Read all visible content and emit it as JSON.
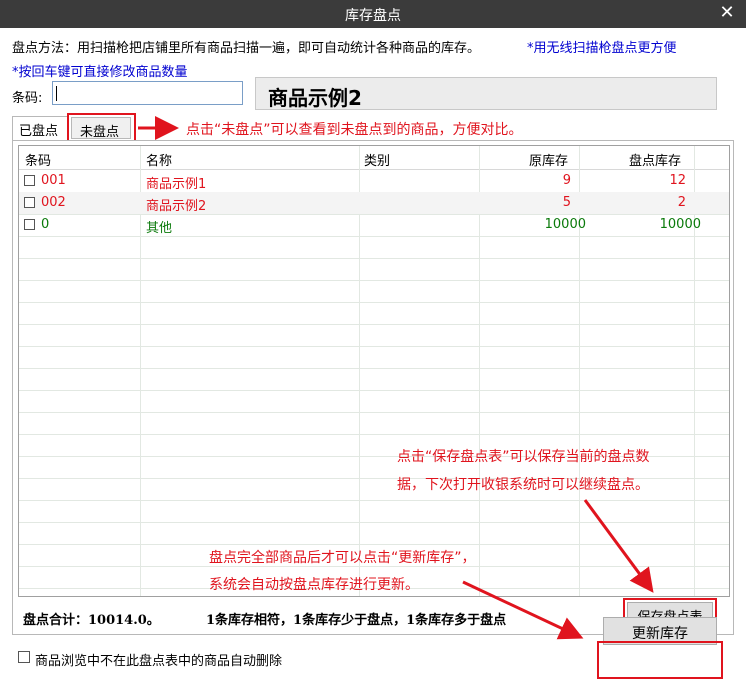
{
  "window": {
    "title": "库存盘点",
    "close_glyph": "✕"
  },
  "info": {
    "method_text": "盘点方法：用扫描枪把店铺里所有商品扫描一遍，即可自动统计各种商品的库存。",
    "wireless_tip": "*用无线扫描枪盘点更方便",
    "enter_tip": "*按回车键可直接修改商品数量"
  },
  "barcode": {
    "label": "条码:",
    "value": ""
  },
  "product_name": "商品示例2",
  "tabs": {
    "counted": "已盘点",
    "uncounted": "未盘点"
  },
  "table": {
    "headers": [
      "条码",
      "名称",
      "类别",
      "原库存",
      "盘点库存"
    ],
    "rows": [
      {
        "code": "001",
        "name": "商品示例1",
        "category": "",
        "orig": "9",
        "count": "12",
        "color": "#e0141e"
      },
      {
        "code": "002",
        "name": "商品示例2",
        "category": "",
        "orig": "5",
        "count": "2",
        "color": "#e0141e"
      },
      {
        "code": "0",
        "name": "其他",
        "category": "",
        "orig": "10000",
        "count": "10000",
        "color": "#0a7a0a"
      }
    ]
  },
  "summary": {
    "total": "盘点合计：10014.0。",
    "detail": "1条库存相符，1条库存少于盘点，1条库存多于盘点"
  },
  "buttons": {
    "save": "保存盘点表",
    "update": "更新库存"
  },
  "auto_delete_label": "商品浏览中不在此盘点表中的商品自动删除",
  "annotations": {
    "uncounted_tip": "点击“未盘点”可以查看到未盘点到的商品，方便对比。",
    "save_tip_line1": "点击“保存盘点表”可以保存当前的盘点数",
    "save_tip_line2": "据，下次打开收银系统时可以继续盘点。",
    "update_tip_line1": "盘点完全部商品后才可以点击“更新库存”，",
    "update_tip_line2": "系统会自动按盘点库存进行更新。"
  },
  "colors": {
    "annotation": "#e0141e",
    "titlebar": "#3b3b3b",
    "tip_blue": "#0000d0"
  }
}
